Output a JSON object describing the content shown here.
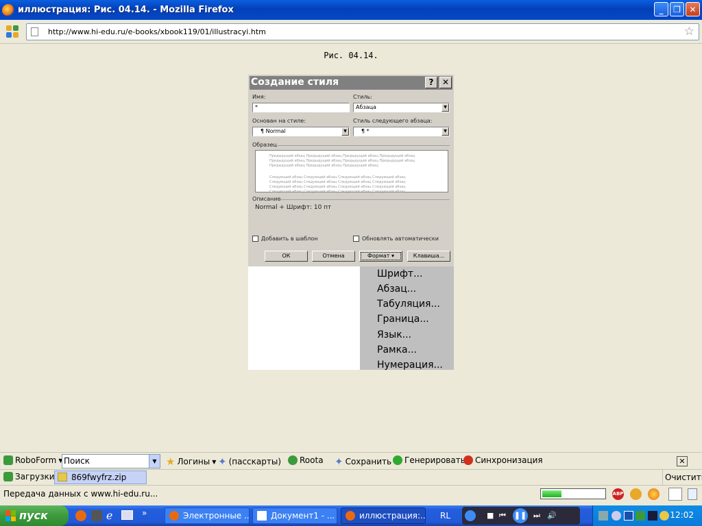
{
  "window": {
    "title": "иллюстрация: Рис. 04.14. - Mozilla Firefox"
  },
  "navbar": {
    "url": "http://www.hi-edu.ru/e-books/xbook119/01/illustracyi.htm"
  },
  "page": {
    "caption": "Рис. 04.14."
  },
  "dialog": {
    "title": "Создание стиля",
    "help_label": "?",
    "close_label": "✕",
    "name_label": "Имя:",
    "name_value": "*",
    "type_label": "Стиль:",
    "type_value": "Абзаца",
    "based_on_label": "Основан на стиле:",
    "based_on_value": "¶ Normal",
    "next_label": "Стиль следующего абзаца:",
    "next_value": "¶ *",
    "sample_label": "Образец",
    "sample_prev": "Предыдущий абзац Предыдущий абзац Предыдущий абзац Предыдущий абзац Предыдущий абзац Предыдущий абзац Предыдущий абзац Предыдущий абзац Предыдущий абзац Предыдущий абзац Предыдущий абзац",
    "sample_next": "Следующий абзац Следующий абзац Следующий абзац Следующий абзац Следующий абзац Следующий абзац Следующий абзац Следующий абзац Следующий абзац Следующий абзац Следующий абзац Следующий абзац Следующий абзац Следующий абзац Следующий абзац Следующий абзац",
    "description_label": "Описание",
    "description_value": "Normal + Шрифт: 10 пт",
    "add_template_label": "Добавить в шаблон",
    "auto_update_label": "Обновлять автоматически",
    "ok_label": "ОК",
    "cancel_label": "Отмена",
    "format_label": "Формат ▾",
    "shortcut_label": "Клавиша..."
  },
  "format_menu": {
    "items": [
      "Шрифт...",
      "Абзац...",
      "Табуляция...",
      "Граница...",
      "Язык...",
      "Рамка...",
      "Нумерация..."
    ]
  },
  "toolbar": {
    "roboform": "RoboForm",
    "search": "Поиск",
    "logins": "Логины",
    "passcards": "(пасскарты)",
    "roota": "Roota",
    "save": "Сохранить",
    "generate": "Генерировать",
    "sync": "Синхронизация"
  },
  "downloads": {
    "label": "Загрузки",
    "file": "869fwyfrz.zip",
    "clear": "Очистить"
  },
  "status": {
    "text": "Передача данных с www.hi-edu.ru...",
    "progress": 0.3
  },
  "taskbar": {
    "start": "пуск",
    "tasks": [
      "Электронные ...",
      "Документ1 - ...",
      "иллюстрация:..."
    ],
    "lang": "RL",
    "clock": "12:02"
  },
  "colors": {
    "titlebar": "#0A5FE0",
    "taskbar": "#245EDC",
    "start": "#3C9A3C",
    "tray": "#0F8CE6"
  }
}
